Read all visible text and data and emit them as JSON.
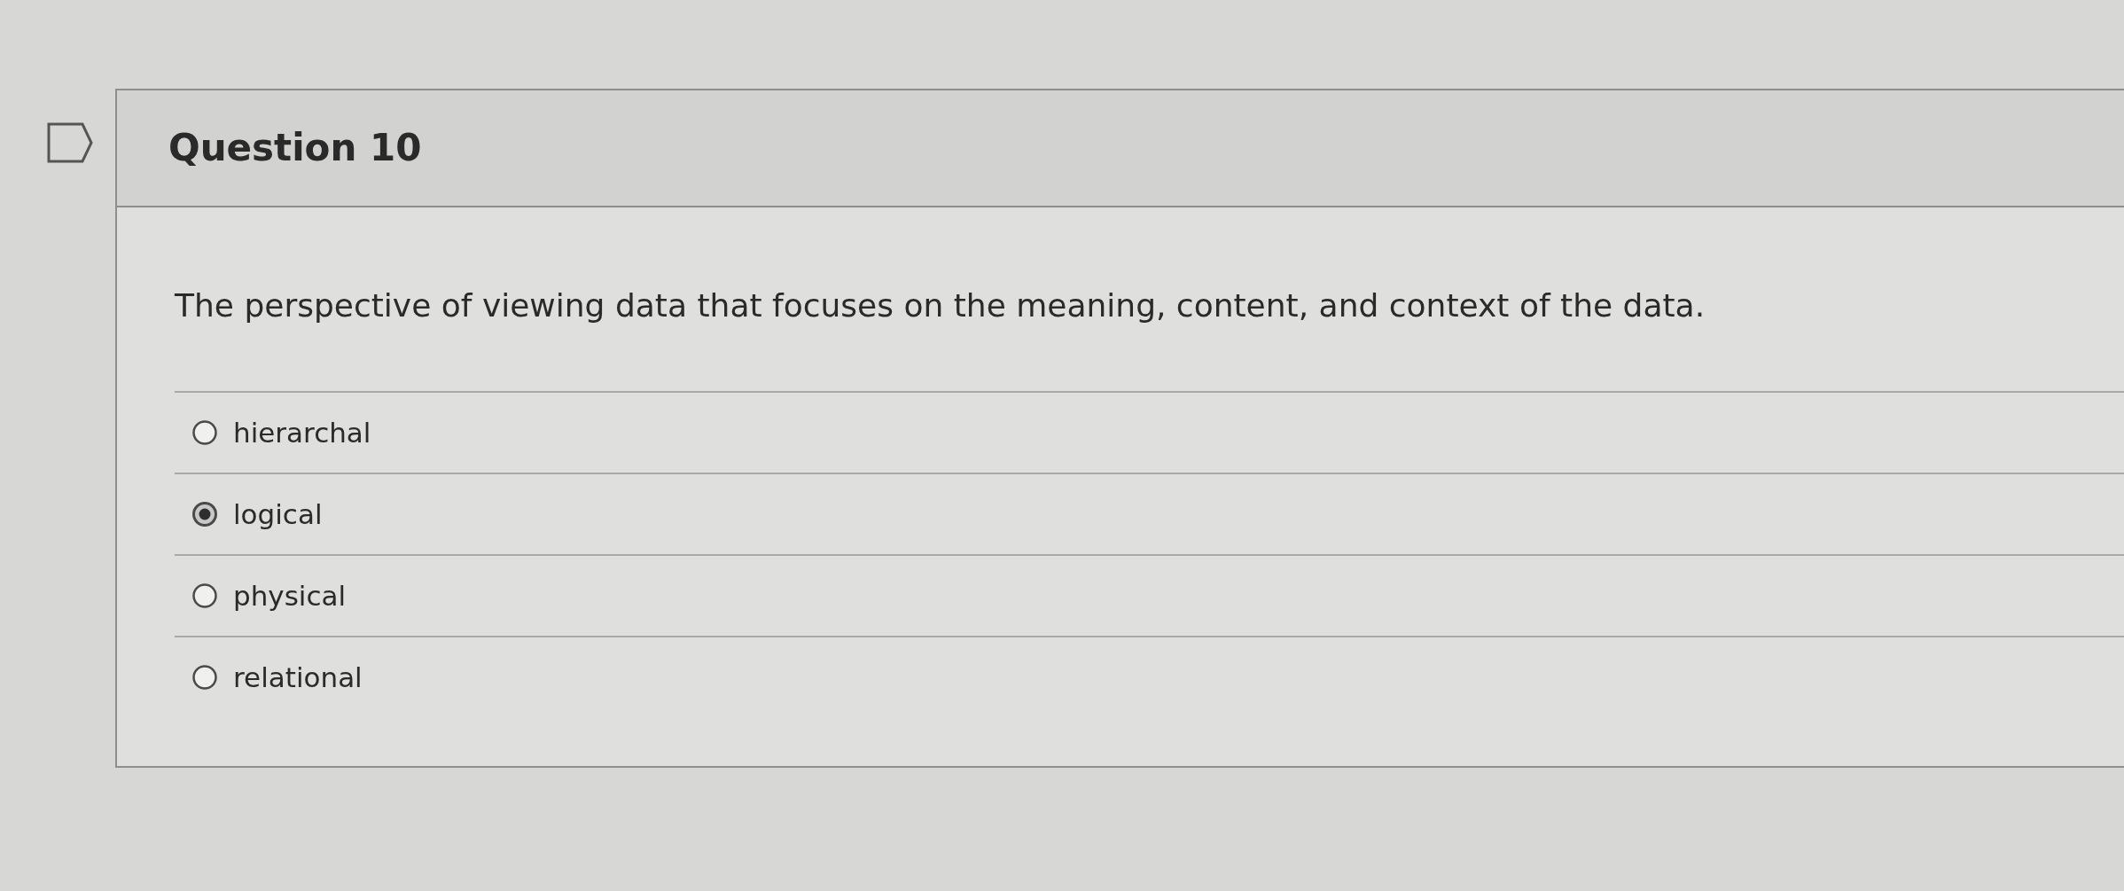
{
  "question": {
    "title": "Question 10",
    "prompt": "The perspective of viewing data that focuses on the meaning, content, and context of the data.",
    "options": [
      {
        "label": "hierarchal",
        "selected": false
      },
      {
        "label": "logical",
        "selected": true
      },
      {
        "label": "physical",
        "selected": false
      },
      {
        "label": "relational",
        "selected": false
      }
    ]
  }
}
